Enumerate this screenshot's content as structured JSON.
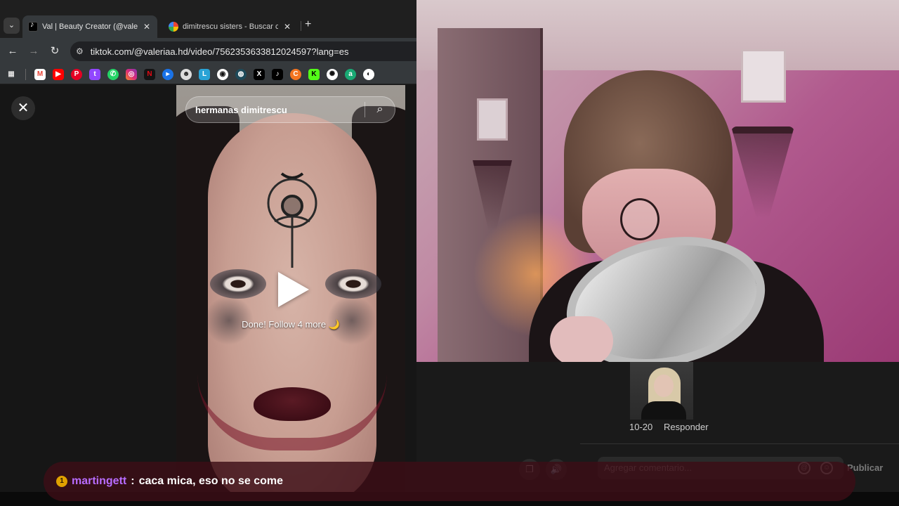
{
  "browser": {
    "tabs": [
      {
        "title": "Val | Beauty Creator (@valeriaa.",
        "favicon": "tiktok-icon",
        "active": true
      },
      {
        "title": "dimitrescu sisters - Buscar con G",
        "favicon": "google-icon",
        "active": false
      }
    ],
    "url": "tiktok.com/@valeriaa.hd/video/7562353633812024597?lang=es",
    "bookmarks": [
      "gmail",
      "youtube",
      "pinterest",
      "twitch",
      "whatsapp",
      "instagram",
      "netflix",
      "play",
      "cat",
      "l",
      "circle",
      "globe",
      "x",
      "tiktok",
      "crunchyroll",
      "kick",
      "openai",
      "ao3",
      "web"
    ]
  },
  "tiktok": {
    "search_query": "hermanas dimitrescu",
    "caption": "Done! Follow 4 more 🌙"
  },
  "comments": {
    "date": "10-20",
    "reply_label": "Responder",
    "input_placeholder": "Agregar comentario...",
    "post_label": "Publicar"
  },
  "chat": {
    "badge": "1",
    "username": "martingett",
    "separator": ":",
    "message": "caca mica, eso no se come"
  },
  "colors": {
    "chat_username": "#b86cff",
    "chat_background": "#3c0e16"
  }
}
